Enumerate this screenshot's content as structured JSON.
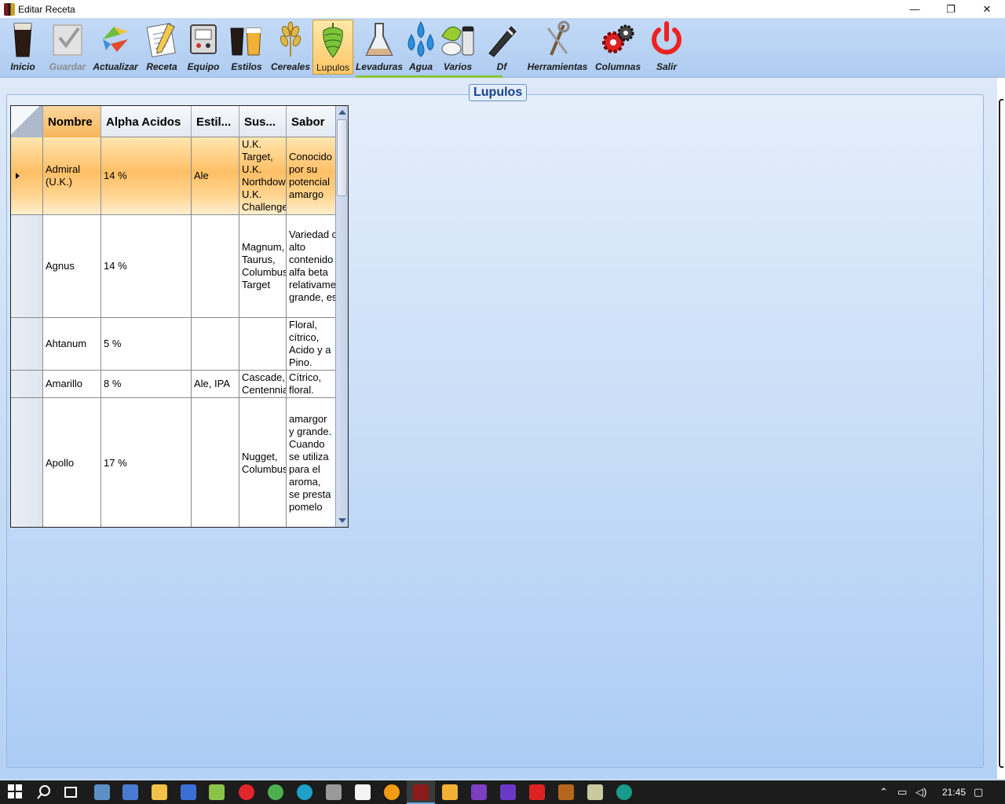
{
  "window": {
    "title": "Editar Receta",
    "minimize": "—",
    "restore": "❐",
    "close": "✕"
  },
  "toolbar": {
    "items": [
      {
        "label": "Inicio",
        "icon": "pint-glass-icon"
      },
      {
        "label": "Guardar",
        "icon": "save-checkmark-icon",
        "disabled": true
      },
      {
        "label": "Actualizar",
        "icon": "refresh-arrows-icon"
      },
      {
        "label": "Receta",
        "icon": "notepad-pencil-icon"
      },
      {
        "label": "Equipo",
        "icon": "brewing-equipment-icon"
      },
      {
        "label": "Estilos",
        "icon": "beer-glasses-icon"
      },
      {
        "label": "Cereales",
        "icon": "wheat-icon"
      },
      {
        "label": "Lupulos",
        "icon": "hop-cone-icon",
        "selected": true
      },
      {
        "label": "Levaduras",
        "icon": "flask-icon"
      },
      {
        "label": "Agua",
        "icon": "water-drops-icon"
      },
      {
        "label": "Varios",
        "icon": "misc-ingredients-icon"
      },
      {
        "label": "Df",
        "icon": "refractometer-icon"
      },
      {
        "label": "Herramientas",
        "icon": "tools-icon"
      },
      {
        "label": "Columnas",
        "icon": "gears-icon"
      },
      {
        "label": "Salir",
        "icon": "power-icon"
      }
    ]
  },
  "panel": {
    "title": "Lupulos"
  },
  "grid": {
    "columns": [
      "Nombre",
      "Alpha Acidos",
      "Estil...",
      "Sus...",
      "Sabor"
    ],
    "rows": [
      {
        "nombre": "Admiral (U.K.)",
        "alpha": "14 %",
        "estilo": "Ale",
        "sustitutos": "U.K. Target, U.K. Northdown, U.K. Challenger",
        "sabor": "Conocido por su potencial amargo",
        "selected": true
      },
      {
        "nombre": "Agnus",
        "alpha": "14 %",
        "estilo": "",
        "sustitutos": "Magnum, Taurus, Columbus, Target",
        "sabor": "Variedad con alto contenido de alfa beta relativamente grande, este"
      },
      {
        "nombre": "Ahtanum",
        "alpha": "5 %",
        "estilo": "",
        "sustitutos": "",
        "sabor": "Floral, cítrico, Acido y a Pino."
      },
      {
        "nombre": "Amarillo",
        "alpha": "8 %",
        "estilo": "Ale, IPA",
        "sustitutos": "Cascade, Centennial",
        "sabor": "Cítrico, floral."
      },
      {
        "nombre": "Apollo",
        "alpha": "17 %",
        "estilo": "",
        "sustitutos": "Nugget, Columbus",
        "sabor": "amargor y grande. Cuando se utiliza para el aroma, se presta pomelo"
      }
    ]
  },
  "taskbar": {
    "time": "21:45"
  }
}
